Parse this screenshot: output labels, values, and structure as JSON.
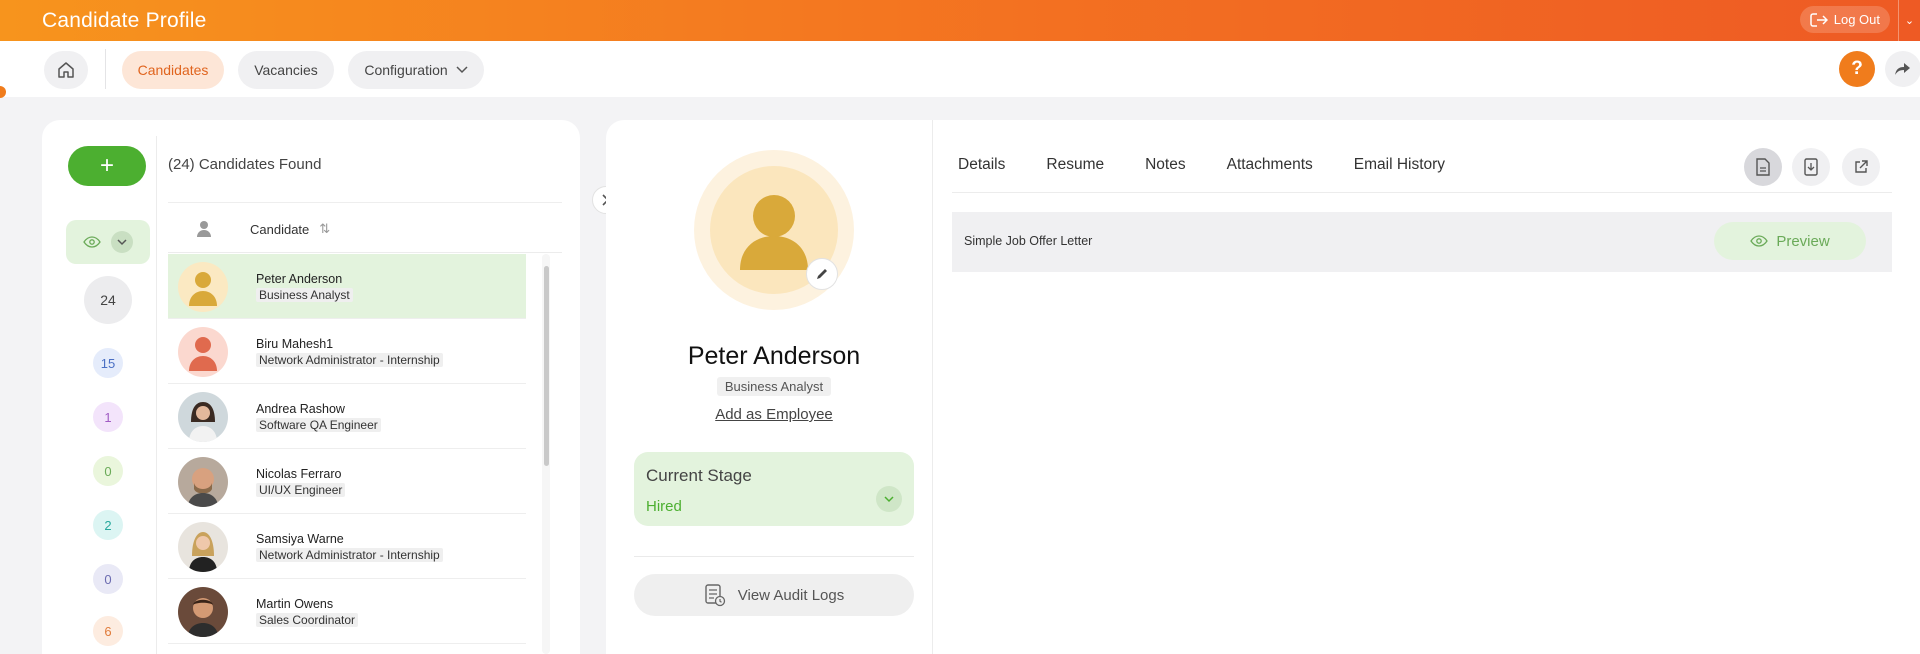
{
  "header": {
    "title": "Candidate Profile",
    "logout_label": "Log Out"
  },
  "nav": {
    "items": [
      {
        "label": "Candidates",
        "active": true
      },
      {
        "label": "Vacancies",
        "active": false
      },
      {
        "label": "Configuration",
        "active": false
      }
    ],
    "help_label": "?"
  },
  "sidebar": {
    "add_label": "+",
    "counts": [
      "24",
      "15",
      "1",
      "0",
      "2",
      "0",
      "6"
    ]
  },
  "list": {
    "found_text": "(24) Candidates Found",
    "column_label": "Candidate",
    "rows": [
      {
        "name": "Peter Anderson",
        "role": "Business Analyst"
      },
      {
        "name": "Biru Mahesh1",
        "role": "Network Administrator - Internship"
      },
      {
        "name": "Andrea Rashow",
        "role": "Software QA Engineer"
      },
      {
        "name": "Nicolas Ferraro",
        "role": "UI/UX Engineer"
      },
      {
        "name": "Samsiya Warne",
        "role": "Network Administrator - Internship"
      },
      {
        "name": "Martin Owens",
        "role": "Sales Coordinator"
      }
    ]
  },
  "profile": {
    "name": "Peter Anderson",
    "role": "Business Analyst",
    "add_employee": "Add as Employee",
    "stage_label": "Current Stage",
    "stage_value": "Hired",
    "audit_label": "View Audit Logs"
  },
  "detail": {
    "tabs": [
      "Details",
      "Resume",
      "Notes",
      "Attachments",
      "Email History"
    ],
    "document_name": "Simple Job Offer Letter",
    "preview_label": "Preview"
  },
  "colors": {
    "brand": "#f37021",
    "accent_green": "#4caf30",
    "selected_bg": "#e3f3dd"
  }
}
